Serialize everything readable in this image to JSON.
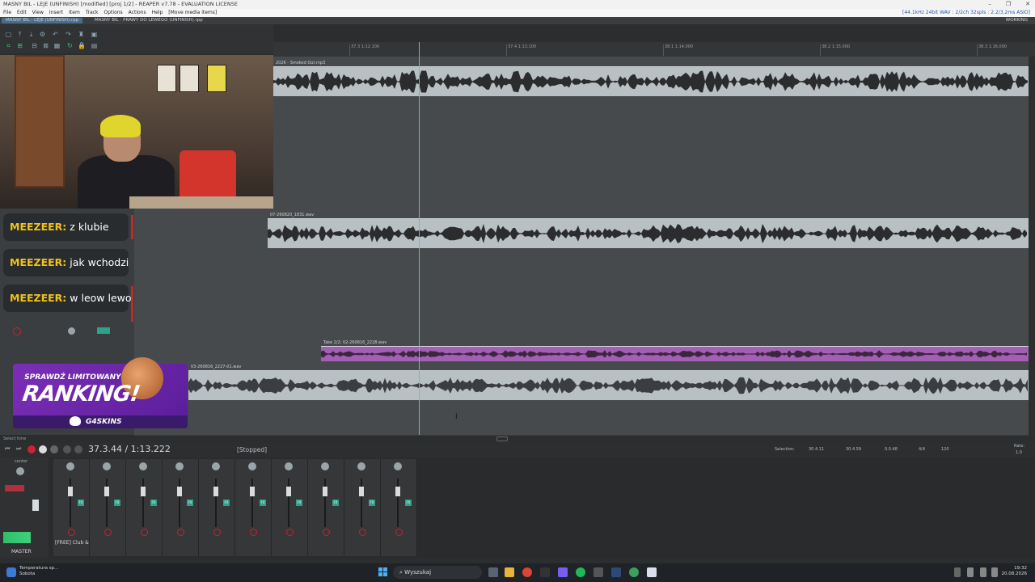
{
  "window": {
    "title": "MASNY BIL - LEJE (UNFINISH) [modified] [proj 1/2] - REAPER v7.78 - EVALUATION LICENSE",
    "controls": [
      "–",
      "❐",
      "✕"
    ]
  },
  "menu": {
    "items": [
      "File",
      "Edit",
      "View",
      "Insert",
      "Item",
      "Track",
      "Options",
      "Actions",
      "Help",
      "[Move media items]"
    ],
    "audio_status": "[44.1kHz 24bit WAV : 2/2ch 32spls : 2.2/3.2ms ASIO]"
  },
  "project_tabs": [
    {
      "label": "MASNY BIL - LEJE (UNFINISH).rpp"
    },
    {
      "label": "MASNY BIL - PRAWY DO LEWEGO (UNFINISH).rpp"
    }
  ],
  "project_tab_right": "WORKING",
  "ruler": {
    "marks": [
      "37.3\n1:12.100",
      "37.4\n1:13.100",
      "38.1\n1:14.000",
      "38.2\n1:15.000",
      "38.3\n1:16.000"
    ]
  },
  "items": {
    "item1": "2026 - Smoked Out.mp3",
    "item2": "07-260820_1831.wav",
    "item3": "Take 2/2: 02-260816_2228.wav",
    "item4": "03-260816_2227-01.wav"
  },
  "chat": [
    {
      "user": "MEEZEER:",
      "msg": "z klubie"
    },
    {
      "user": "MEEZEER:",
      "msg": "jak wchodzi"
    },
    {
      "user": "MEEZEER:",
      "msg": "w leow lewo"
    }
  ],
  "ad": {
    "line1": "SPRAWDŹ LIMITOWANY",
    "line2": "RANKING!",
    "brand": "G4SKINS"
  },
  "transport": {
    "time": "37.3.44 / 1:13.222",
    "status": "[Stopped]",
    "select_time": "Select time",
    "selection_label": "Selection:",
    "sel_start": "30.4.11",
    "sel_end": "30.4.59",
    "sel_len": "0.0.48",
    "time_sig": "4/4",
    "bpm": "120",
    "rate_label": "Rate:",
    "rate": "1.0"
  },
  "mixer": {
    "master_label": "MASTER",
    "master_sublabel": "center",
    "strip_label": "[FREE] Club &",
    "strip_count": 10
  },
  "taskbar": {
    "weather_title": "Temperatura sp...",
    "weather_sub": "Sobota",
    "search": "Wyszukaj",
    "time": "19:32",
    "date": "20.08.2026"
  },
  "colors": {
    "accent": "#5fc3b8",
    "selected_item": "#a35fb3",
    "chat_user": "#f0c21c"
  }
}
